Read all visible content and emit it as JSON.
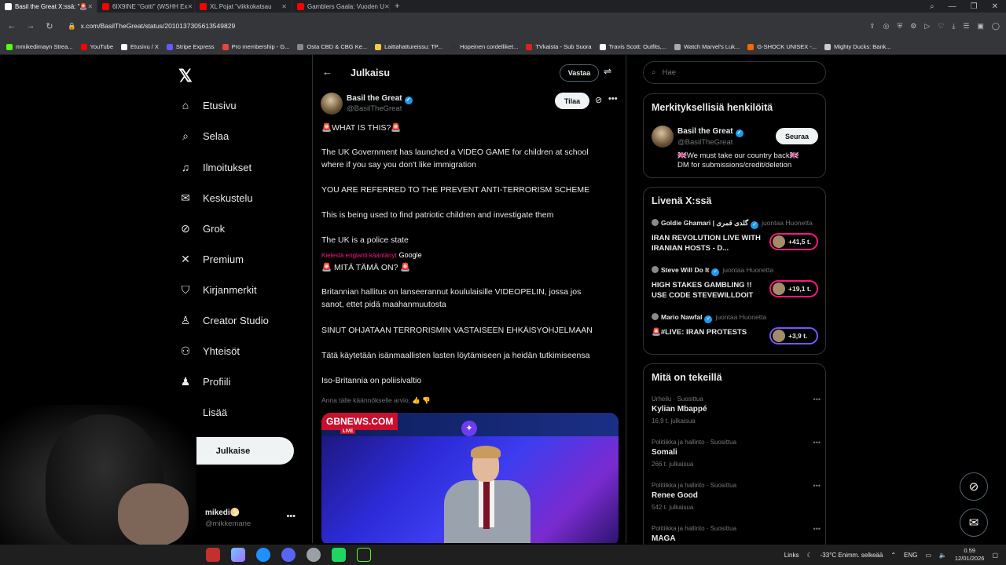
{
  "browser": {
    "tabs": [
      {
        "label": "Basil the Great X:ssä: \"🚨",
        "active": true,
        "color": "#ffffff"
      },
      {
        "label": "6IX9INE \"Gotti\" (WSHH Ex",
        "active": false,
        "color": "#ff0000"
      },
      {
        "label": "XL Pojat \"viikkokatsau",
        "active": false,
        "color": "#ff0000"
      },
      {
        "label": "Gamblers Gaala: Vuoden U",
        "active": false,
        "color": "#ff0000"
      }
    ],
    "new_tab": "+",
    "url": "x.com/BasilTheGreat/status/2010137305613549829",
    "bookmarks": [
      {
        "label": "mmikedimayn Strea...",
        "color": "#53fc18"
      },
      {
        "label": "YouTube",
        "color": "#ff0000"
      },
      {
        "label": "Etusivu / X",
        "color": "#ffffff"
      },
      {
        "label": "Stripe Express",
        "color": "#635bff"
      },
      {
        "label": "Pro membership - G...",
        "color": "#e8453c"
      },
      {
        "label": "Osta CBD & CBG Ke...",
        "color": "#888888"
      },
      {
        "label": "Laittahattureissu: TP...",
        "color": "#f2c94c"
      },
      {
        "label": "Hopeinen cordelliket...",
        "color": "#333333"
      },
      {
        "label": "TVkaista - Sub Suora",
        "color": "#e02020"
      },
      {
        "label": "Travis Scott: Outfits,...",
        "color": "#ffffff"
      },
      {
        "label": "Watch Marvel's Luk...",
        "color": "#aaaaaa"
      },
      {
        "label": "G-SHOCK UNISEX -...",
        "color": "#ff6600"
      },
      {
        "label": "Mighty Ducks: Bank...",
        "color": "#cccccc"
      }
    ]
  },
  "nav": {
    "items": [
      {
        "label": "Etusivu",
        "icon": "home-icon",
        "glyph": "⌂"
      },
      {
        "label": "Selaa",
        "icon": "search-icon",
        "glyph": "⌕"
      },
      {
        "label": "Ilmoitukset",
        "icon": "bell-icon",
        "glyph": "🔔"
      },
      {
        "label": "Keskustelu",
        "icon": "mail-icon",
        "glyph": "✉"
      },
      {
        "label": "Grok",
        "icon": "grok-icon",
        "glyph": "⊘"
      },
      {
        "label": "Premium",
        "icon": "x-premium-icon",
        "glyph": "𝕏"
      },
      {
        "label": "Kirjanmerkit",
        "icon": "bookmark-icon",
        "glyph": "🔖"
      },
      {
        "label": "Creator Studio",
        "icon": "creator-icon",
        "glyph": "♙"
      },
      {
        "label": "Yhteisöt",
        "icon": "communities-icon",
        "glyph": "👥"
      },
      {
        "label": "Profiili",
        "icon": "profile-icon",
        "glyph": "👤"
      },
      {
        "label": "Lisää",
        "icon": "more-icon",
        "glyph": "⋯"
      }
    ],
    "post_button": "Julkaise",
    "account": {
      "name": "mikedi🌕",
      "handle": "@mikkemane"
    }
  },
  "main": {
    "title": "Julkaisu",
    "reply_button": "Vastaa",
    "author": {
      "name": "Basil the Great",
      "handle": "@BasilTheGreat"
    },
    "subscribe_button": "Tilaa",
    "paragraphs": [
      "🚨WHAT IS THIS?🚨",
      "The UK Government has launched a VIDEO GAME for children at school",
      "where if you say you don't like immigration",
      "YOU ARE REFERRED TO THE PREVENT ANTI-TERRORISM SCHEME",
      "This is being used to find patriotic children and investigate them",
      "The UK is a police state"
    ],
    "translate_link": "Kielestä englanti kääntänyt",
    "translate_provider": "Google",
    "translated": [
      "🚨 MITÄ TÄMÄ ON? 🚨",
      "Britannian hallitus on lanseerannut koululaisille VIDEOPELIN, jossa jos",
      "sanot, ettet pidä maahanmuutosta",
      "SINUT OHJATAAN TERRORISMIN VASTAISEEN EHKÄISYOHJELMAAN",
      "Tätä käytetään isänmaallisten lasten löytämiseen ja heidän tutkimiseensa",
      "Iso-Britannia on poliisivaltio"
    ],
    "rate_translation": "Anna tälle käännökselle arvio:",
    "media": {
      "brand": "GBNEWS.COM",
      "live": "LIVE"
    }
  },
  "right": {
    "search_placeholder": "Hae",
    "relevant": {
      "title": "Merkityksellisiä henkilöitä",
      "name": "Basil the Great",
      "handle": "@BasilTheGreat",
      "follow_button": "Seuraa",
      "bio1": "🇬🇧We must take our country back🇬🇧",
      "bio2": "DM for submissions/credit/deletion"
    },
    "live": {
      "title": "Livenä X:ssä",
      "items": [
        {
          "host": "Goldie Ghamari | گلدی قمری",
          "role": "juontaa Huonetta",
          "title": "IRAN REVOLUTION LIVE WITH IRANIAN HOSTS - D...",
          "count": "+41,5 t.",
          "color": "#f91880"
        },
        {
          "host": "Steve Will Do It",
          "role": "juontaa Huonetta",
          "title": "HIGH STAKES GAMBLING !! USE CODE STEVEWILLDOIT",
          "count": "+19,1 t.",
          "color": "#f91880"
        },
        {
          "host": "Mario Nawfal",
          "role": "juontaa Huonetta",
          "title": "🚨#LIVE: IRAN PROTESTS",
          "count": "+3,9 t.",
          "color": "#7856ff"
        }
      ]
    },
    "trends": {
      "title": "Mitä on tekeillä",
      "items": [
        {
          "category": "Urheilu · Suosittua",
          "name": "Kylian Mbappé",
          "count": "16,9 t. julkaisua"
        },
        {
          "category": "Politiikka ja hallinto · Suosittua",
          "name": "Somali",
          "count": "266 t. julkaisua"
        },
        {
          "category": "Politiikka ja hallinto · Suosittua",
          "name": "Renee Good",
          "count": "542 t. julkaisua"
        },
        {
          "category": "Politiikka ja hallinto · Suosittua",
          "name": "MAGA",
          "count": ""
        }
      ]
    }
  },
  "taskbar": {
    "links": "Links",
    "weather": "-33°C  Enimm. selkeää",
    "lang": "ENG",
    "time": "0.59",
    "date": "12/01/2026"
  }
}
